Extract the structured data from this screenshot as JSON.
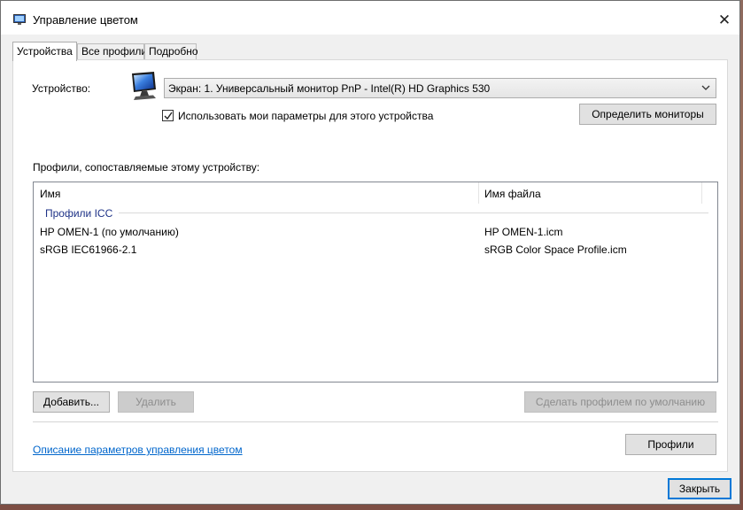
{
  "window": {
    "title": "Управление цветом",
    "close_glyph": "✕"
  },
  "tabs": [
    {
      "label": "Устройства",
      "active": true
    },
    {
      "label": "Все профили",
      "active": false
    },
    {
      "label": "Подробно",
      "active": false
    }
  ],
  "device": {
    "label": "Устройство:",
    "icon": "monitor-icon",
    "selected": "Экран: 1. Универсальный монитор PnP - Intel(R) HD Graphics 530",
    "use_settings_label": "Использовать мои параметры для этого устройства",
    "use_settings_checked": true,
    "identify_button": "Определить мониторы"
  },
  "profiles": {
    "heading": "Профили, сопоставляемые этому устройству:",
    "columns": [
      "Имя",
      "Имя файла"
    ],
    "group": "Профили ICC",
    "rows": [
      {
        "name": "HP OMEN-1 (по умолчанию)",
        "file": "HP OMEN-1.icm"
      },
      {
        "name": "sRGB IEC61966-2.1",
        "file": "sRGB Color Space Profile.icm"
      }
    ]
  },
  "actions": {
    "add": "Добавить...",
    "remove": "Удалить",
    "set_default": "Сделать профилем по умолчанию"
  },
  "footer": {
    "link": "Описание параметров управления цветом",
    "profiles_button": "Профили",
    "close_button": "Закрыть"
  },
  "colors": {
    "link": "#0066cc",
    "group_label": "#1e3287",
    "default_button_border": "#0078d7"
  }
}
